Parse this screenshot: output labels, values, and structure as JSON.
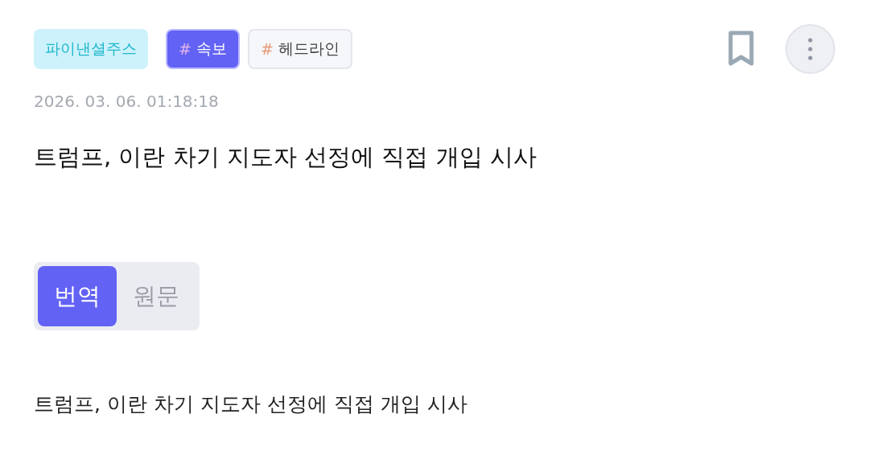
{
  "tags": [
    {
      "kind": "source",
      "label": "파이낸셜주스"
    },
    {
      "kind": "accent",
      "mark": "#",
      "label": "속보"
    },
    {
      "kind": "plain",
      "mark": "#",
      "label": "헤드라인"
    }
  ],
  "timestamp": "2026. 03. 06. 01:18:18",
  "headline": "트럼프, 이란 차기 지도자 선정에 직접 개입 시사",
  "tabs": [
    {
      "label": "번역",
      "selected": true
    },
    {
      "label": "원문",
      "selected": false
    }
  ],
  "body": "트럼프, 이란 차기 지도자 선정에 직접 개입 시사"
}
